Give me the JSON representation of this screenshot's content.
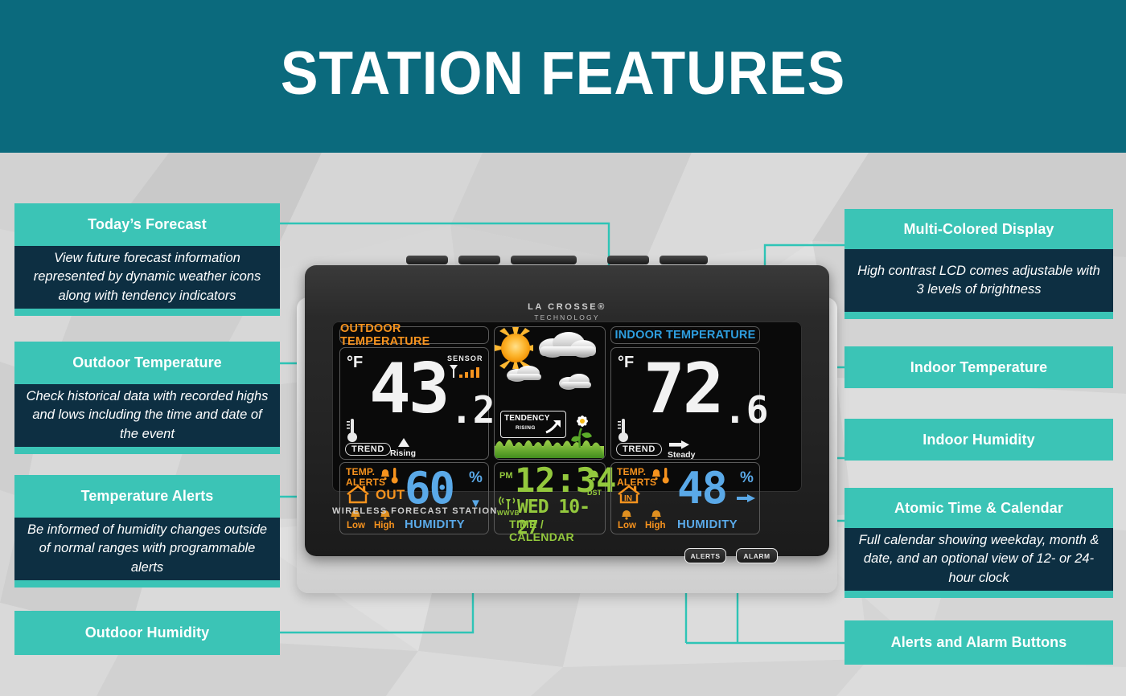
{
  "header": {
    "title": "STATION FEATURES"
  },
  "colors": {
    "header_bg": "#0b6a7d",
    "callout_head": "#3bc4b6",
    "callout_body": "#0d2f42",
    "accent_dot": "#2ec4b6",
    "lcd_orange": "#f7931e",
    "lcd_blue": "#5aa9e8",
    "lcd_green": "#93c83d"
  },
  "callouts_left": [
    {
      "title": "Today’s Forecast",
      "body": "View future forecast information represented by dynamic weather icons along with tendency indicators"
    },
    {
      "title": "Outdoor Temperature",
      "body": "Check historical data with recorded highs and lows including the time and date of the event"
    },
    {
      "title": "Temperature Alerts",
      "body": "Be informed of humidity changes outside of normal ranges with programmable alerts"
    },
    {
      "title": "Outdoor Humidity",
      "body": ""
    }
  ],
  "callouts_right": [
    {
      "title": "Multi-Colored Display",
      "body": "High contrast LCD comes adjustable with 3 levels of brightness"
    },
    {
      "title": "Indoor Temperature",
      "body": ""
    },
    {
      "title": "Indoor Humidity",
      "body": ""
    },
    {
      "title": "Atomic Time & Calendar",
      "body": "Full calendar showing weekday, month & date, and an optional view of 12- or 24-hour clock"
    },
    {
      "title": "Alerts and Alarm Buttons",
      "body": ""
    }
  ],
  "device": {
    "brand_line1": "LA CROSSE®",
    "brand_line2": "TECHNOLOGY",
    "model_label": "WIRELESS FORECAST STATION",
    "buttons": [
      {
        "label": "ALERTS",
        "name": "alerts-button"
      },
      {
        "label": "ALARM",
        "name": "alarm-button"
      }
    ],
    "outdoor": {
      "panel_label": "OUTDOOR TEMPERATURE",
      "unit": "°F",
      "value_int": "43",
      "value_dec": ".2",
      "sensor_label": "SENSOR",
      "trend_pill": "TREND",
      "trend_text": "Rising",
      "trend_arrow": "▲",
      "alerts_line1": "TEMP.",
      "alerts_line2": "ALERTS",
      "location": "OUT",
      "low_label": "Low",
      "high_label": "High",
      "humidity_value": "60",
      "humidity_pct": "%",
      "humidity_label": "HUMIDITY",
      "humidity_arrow": "▼"
    },
    "indoor": {
      "panel_label": "INDOOR TEMPERATURE",
      "unit": "°F",
      "value_int": "72",
      "value_dec": ".6",
      "trend_pill": "TREND",
      "trend_text": "Steady",
      "trend_arrow": "➡",
      "alerts_line1": "TEMP.",
      "alerts_line2": "ALERTS",
      "location": "IN",
      "low_label": "Low",
      "high_label": "High",
      "humidity_value": "48",
      "humidity_pct": "%",
      "humidity_label": "HUMIDITY",
      "humidity_arrow": "➡"
    },
    "forecast": {
      "tendency_label": "TENDENCY",
      "tendency_state": "RISING",
      "icons": "sun-clouds"
    },
    "time_calendar": {
      "meridiem": "PM",
      "time": "12:34",
      "dst": "DST",
      "weekday": "WED",
      "date": "10-27",
      "date_full": "WED 10-27",
      "signal_label": "WWVB",
      "panel_label": "TIME / CALENDAR"
    }
  }
}
